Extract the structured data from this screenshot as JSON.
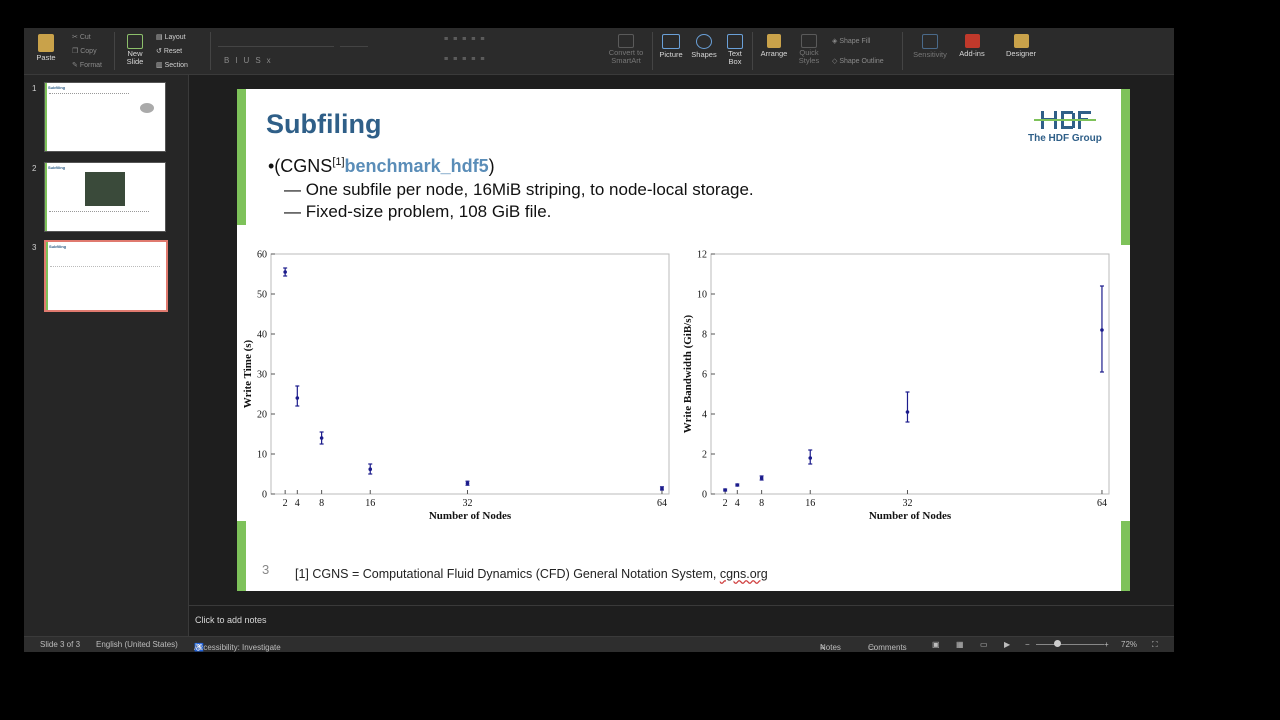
{
  "ribbon": {
    "paste": "Paste",
    "cut": "Cut",
    "copy": "Copy",
    "format": "Format",
    "new_slide": "New\nSlide",
    "layout": "Layout",
    "reset": "Reset",
    "section": "Section",
    "convert_smartart": "Convert to\nSmartArt",
    "picture": "Picture",
    "shapes": "Shapes",
    "text_box": "Text\nBox",
    "arrange": "Arrange",
    "quick_styles": "Quick\nStyles",
    "shape_fill": "Shape Fill",
    "shape_outline": "Shape Outline",
    "sensitivity": "Sensitivity",
    "addins": "Add-ins",
    "designer": "Designer"
  },
  "thumbnails": [
    {
      "num": "1",
      "title": "Subfiling"
    },
    {
      "num": "2",
      "title": "Subfiling"
    },
    {
      "num": "3",
      "title": "Subfiling"
    }
  ],
  "slide": {
    "title": "Subfiling",
    "logo_text": "The HDF Group",
    "bullet_prefix": "•(CGNS",
    "bullet_sup": "[1]",
    "bullet_link": "benchmark_hdf5",
    "bullet_suffix": ")",
    "sub1": "— One subfile per node, 16MiB striping, to node-local storage.",
    "sub2": "— Fixed-size problem, 108 GiB file.",
    "slide_number": "3",
    "footnote_prefix": "[1] CGNS = Computational Fluid Dynamics (CFD) General Notation System, ",
    "footnote_link": "cgns.org"
  },
  "chart_data": [
    {
      "type": "scatter",
      "xlabel": "Number of Nodes",
      "ylabel": "Write Time (s)",
      "xticks": [
        2,
        4,
        8,
        16,
        32,
        64
      ],
      "yticks": [
        0,
        10,
        20,
        30,
        40,
        50,
        60
      ],
      "ylim": [
        0,
        60
      ],
      "x": [
        2,
        4,
        8,
        16,
        32,
        64
      ],
      "y": [
        55.5,
        24,
        14,
        6.2,
        2.7,
        1.4
      ],
      "err_low": [
        54.5,
        22,
        12.5,
        5,
        2.2,
        1.0
      ],
      "err_high": [
        56.5,
        27,
        15.5,
        7.5,
        3.2,
        1.8
      ]
    },
    {
      "type": "scatter",
      "xlabel": "Number of Nodes",
      "ylabel": "Write Bandwidth (GiB/s)",
      "xticks": [
        2,
        4,
        8,
        16,
        32,
        64
      ],
      "yticks": [
        0,
        2,
        4,
        6,
        8,
        10,
        12
      ],
      "ylim": [
        0,
        12
      ],
      "x": [
        2,
        4,
        8,
        16,
        32,
        64
      ],
      "y": [
        0.2,
        0.45,
        0.8,
        1.8,
        4.1,
        8.2
      ],
      "err_low": [
        0.15,
        0.4,
        0.7,
        1.5,
        3.6,
        6.1
      ],
      "err_high": [
        0.25,
        0.5,
        0.9,
        2.2,
        5.1,
        10.4
      ]
    }
  ],
  "notes": {
    "placeholder": "Click to add notes"
  },
  "status": {
    "slide": "Slide 3 of 3",
    "language": "English (United States)",
    "accessibility": "Accessibility: Investigate",
    "notes": "Notes",
    "comments": "Comments",
    "zoom": "72%"
  },
  "colors": {
    "accent_green": "#7ec25a",
    "title_blue": "#2f5f88",
    "link_blue": "#5a8db8",
    "data_blue": "#1c1c8c"
  }
}
